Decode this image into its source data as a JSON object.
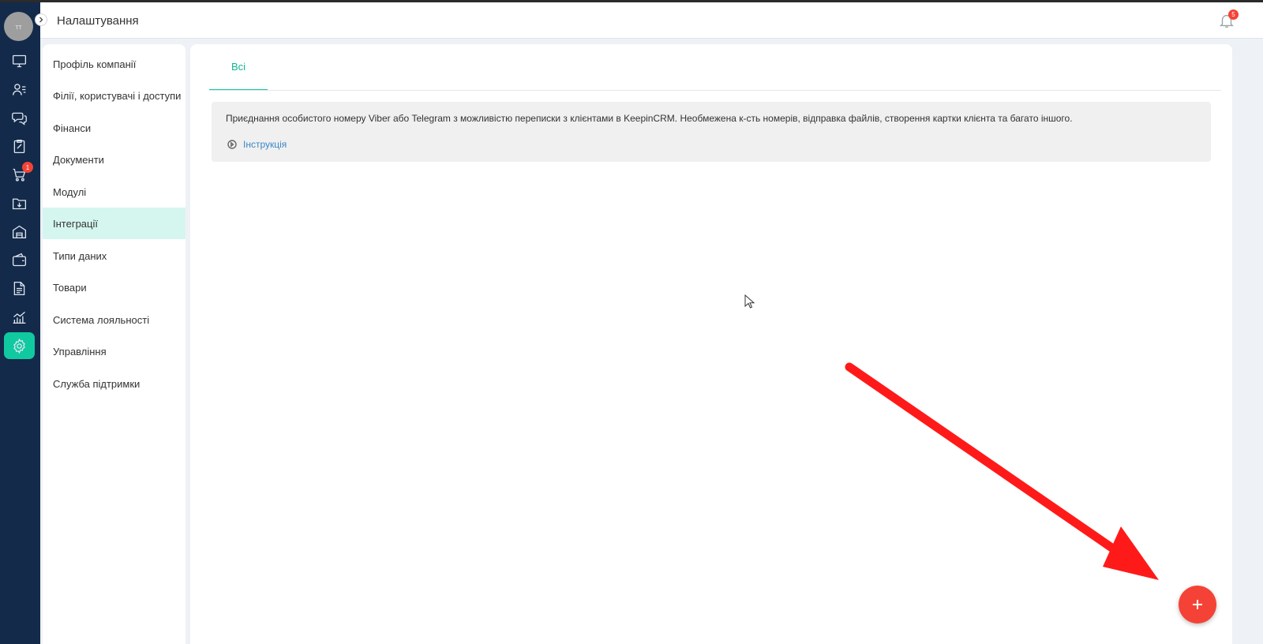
{
  "header": {
    "title": "Налаштування",
    "notifications_count": "5"
  },
  "user": {
    "initials": "тт"
  },
  "rail": {
    "cart_badge": "1",
    "items": [
      {
        "icon": "monitor-icon"
      },
      {
        "icon": "contacts-icon"
      },
      {
        "icon": "chat-icon"
      },
      {
        "icon": "clipboard-icon"
      },
      {
        "icon": "cart-icon"
      },
      {
        "icon": "folder-download-icon"
      },
      {
        "icon": "warehouse-icon"
      },
      {
        "icon": "wallet-icon"
      },
      {
        "icon": "document-icon"
      },
      {
        "icon": "analytics-icon"
      },
      {
        "icon": "gear-icon"
      }
    ]
  },
  "settings_menu": {
    "items": [
      {
        "label": "Профіль компанії"
      },
      {
        "label": "Філії, користувачі і доступи"
      },
      {
        "label": "Фінанси"
      },
      {
        "label": "Документи"
      },
      {
        "label": "Модулі"
      },
      {
        "label": "Інтеграції"
      },
      {
        "label": "Типи даних"
      },
      {
        "label": "Товари"
      },
      {
        "label": "Система лояльності"
      },
      {
        "label": "Управління"
      },
      {
        "label": "Служба підтримки"
      }
    ],
    "active": "Інтеграції"
  },
  "content": {
    "tabs": [
      {
        "label": "Всі"
      }
    ],
    "info": {
      "text": "Приєднання особистого номеру Viber або Telegram з можливістю переписки з клієнтами в KeepinCRM. Необмежена к-сть номерів, відправка файлів, створення картки клієнта та багато іншого.",
      "link": "Інструкція"
    }
  },
  "colors": {
    "rail_bg": "#132a4a",
    "accent": "#10c9a1",
    "active_menu_bg": "#d4f6ee",
    "fab": "#f44336",
    "annotation_arrow": "#ff1a1a",
    "link": "#3a87c9"
  }
}
